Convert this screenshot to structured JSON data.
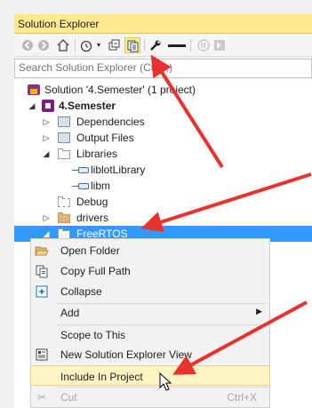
{
  "window": {
    "title": "Solution Explorer"
  },
  "search": {
    "placeholder": "Search Solution Explorer (Ctrl+;)"
  },
  "toolbar": {
    "buttons": [
      "back",
      "forward",
      "home",
      "history",
      "collapse-all",
      "show-all-files",
      "properties",
      "preview",
      "code-view",
      "designer"
    ]
  },
  "tree": {
    "solution_label": "Solution '4.Semester' (1 project)",
    "project_label": "4.Semester",
    "items": [
      {
        "label": "Dependencies"
      },
      {
        "label": "Output Files"
      },
      {
        "label": "Libraries"
      },
      {
        "label": "liblotLibrary"
      },
      {
        "label": "libm"
      },
      {
        "label": "Debug"
      },
      {
        "label": "drivers"
      },
      {
        "label": "FreeRTOS"
      }
    ]
  },
  "context_menu": {
    "items": [
      {
        "label": "Open Folder"
      },
      {
        "label": "Copy Full Path"
      },
      {
        "label": "Collapse"
      },
      {
        "label": "Add"
      },
      {
        "label": "Scope to This"
      },
      {
        "label": "New Solution Explorer View"
      },
      {
        "label": "Include In Project"
      },
      {
        "label": "Cut",
        "shortcut": "Ctrl+X"
      }
    ]
  },
  "colors": {
    "title_bg": "#ffea8f",
    "selection": "#3399ff",
    "menu_highlight": "#fff4c4",
    "annotation_arrow": "#e8322f"
  }
}
